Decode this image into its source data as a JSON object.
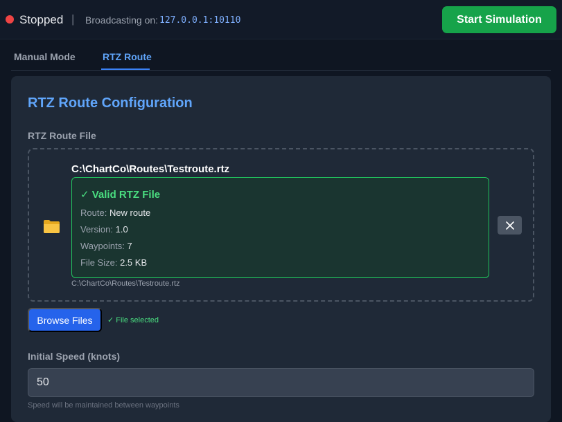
{
  "topbar": {
    "status": "Stopped",
    "divider": "|",
    "broadcast_label": "Broadcasting on:",
    "broadcast_address": "127.0.0.1:10110",
    "start_button": "Start Simulation",
    "status_color": "#ef4444",
    "start_color": "#16a34a"
  },
  "tabs": [
    {
      "label": "Manual Mode",
      "active": false
    },
    {
      "label": "RTZ Route",
      "active": true
    }
  ],
  "panel": {
    "title": "RTZ Route Configuration",
    "file_label": "RTZ Route File",
    "file": {
      "icon": "folder-icon",
      "path": "C:\\ChartCo\\Routes\\Testroute.rtz",
      "valid_title": "✓  Valid RTZ File",
      "route_label": "Route:",
      "route_value": "New route",
      "version_label": "Version:",
      "version_value": "1.0",
      "waypoints_label": "Waypoints:",
      "waypoints_value": "7",
      "size_label": "File Size:",
      "size_value": "2.5 KB",
      "path_small": "C:\\ChartCo\\Routes\\Testroute.rtz",
      "clear_icon": "close-icon"
    },
    "browse_button": "Browse Files",
    "file_selected": "✓ File selected",
    "speed_label": "Initial Speed (knots)",
    "speed_value": "50",
    "speed_hint": "Speed will be maintained between waypoints"
  }
}
